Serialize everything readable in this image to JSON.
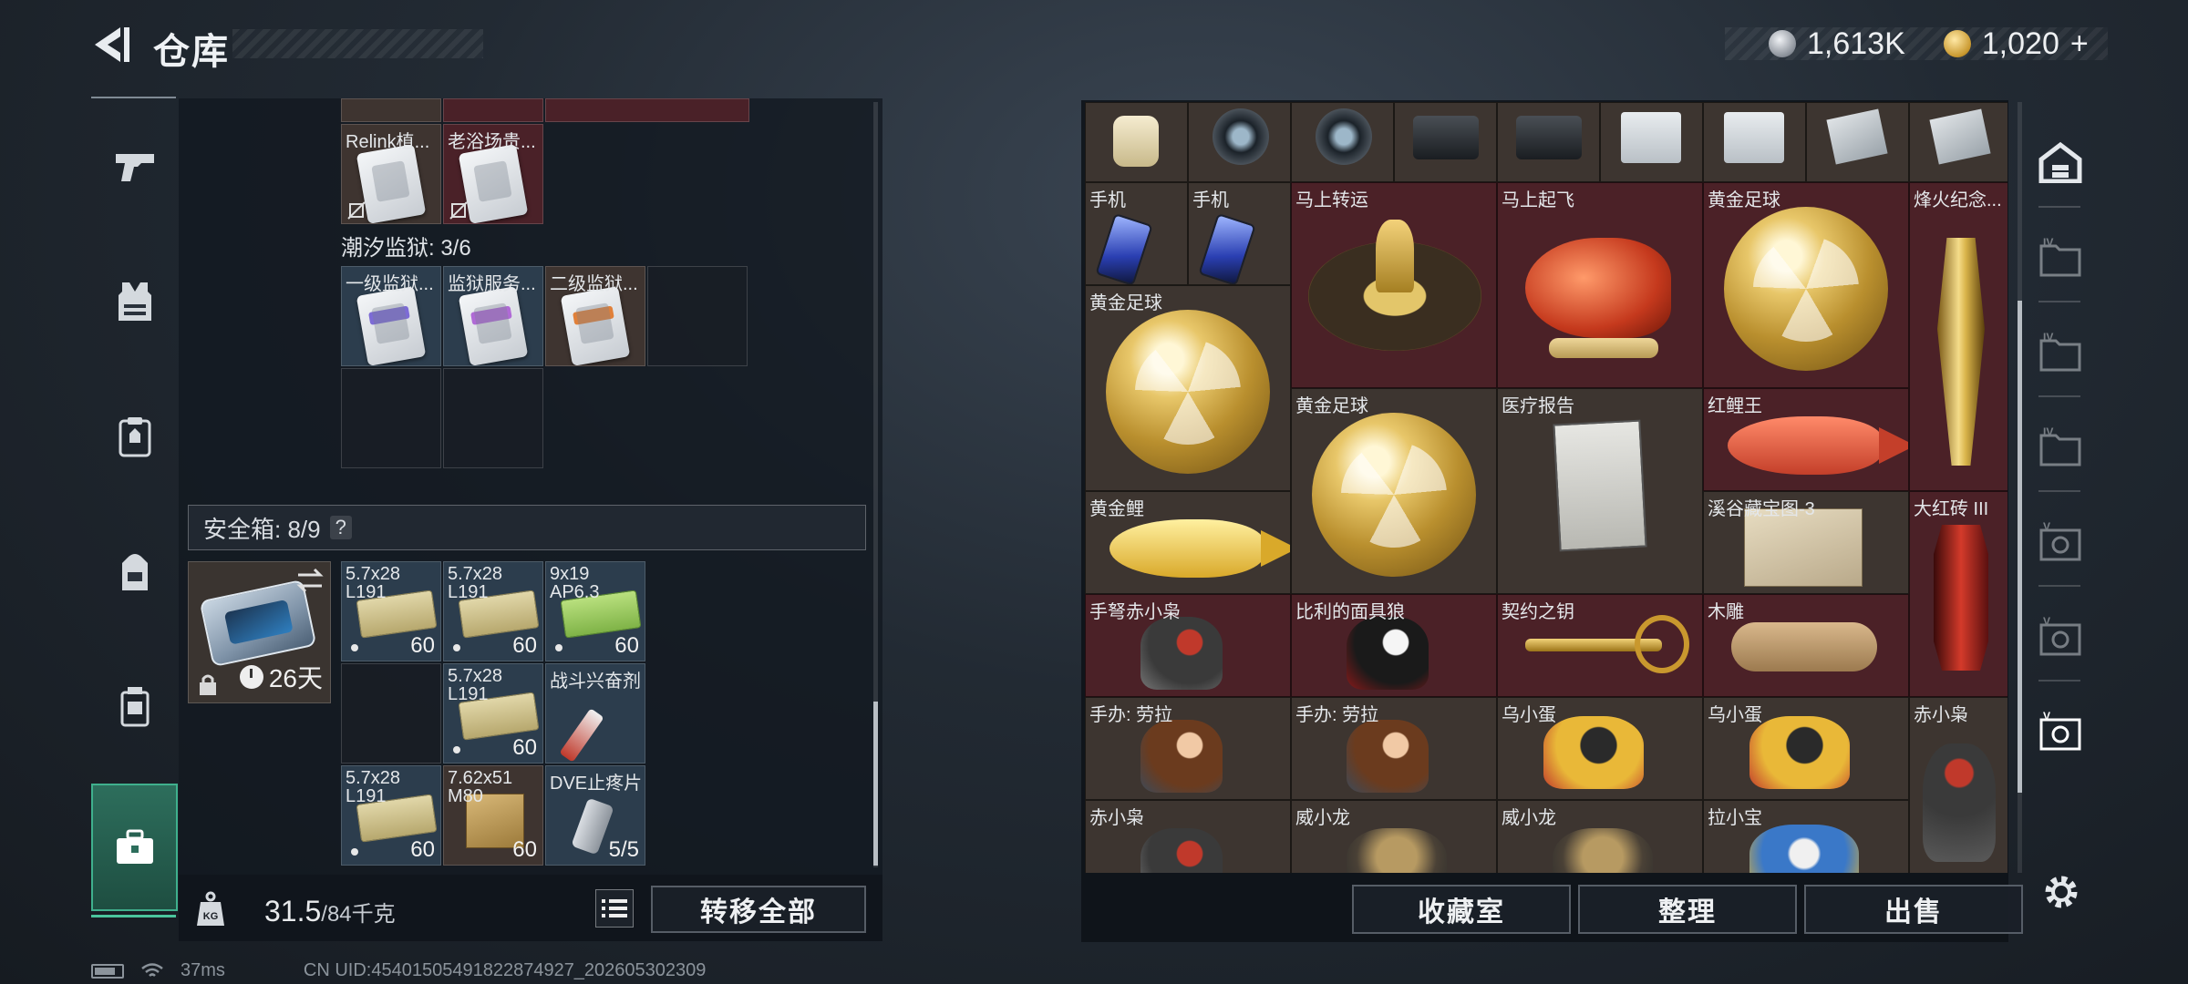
{
  "header": {
    "title": "仓库",
    "silver_amount": "1,613K",
    "gold_amount": "1,020",
    "gold_plus": "+"
  },
  "left_nav": {
    "items": [
      {
        "icon": "pistol-icon"
      },
      {
        "icon": "armor-vest-icon"
      },
      {
        "icon": "chest-rig-icon"
      },
      {
        "icon": "backpack-icon"
      },
      {
        "icon": "pouch-icon"
      },
      {
        "icon": "briefcase-icon"
      }
    ],
    "active_index": 5
  },
  "storage": {
    "top_cells": [
      {
        "label": "Relink植...",
        "bg": "brown"
      },
      {
        "label": "老浴场贵...",
        "bg": "red"
      }
    ],
    "prison_label": "潮汐监狱: 3/6",
    "prison_cells": [
      {
        "label": "一级监狱...",
        "bg": "blue"
      },
      {
        "label": "监狱服务...",
        "bg": "blue"
      },
      {
        "label": "二级监狱...",
        "bg": "brown"
      }
    ]
  },
  "safebox": {
    "label": "安全箱: 8/9",
    "help": "?",
    "days": "26天",
    "items": [
      {
        "line1": "5.7x28",
        "line2": "L191",
        "count": "60"
      },
      {
        "line1": "5.7x28",
        "line2": "L191",
        "count": "60"
      },
      {
        "line1": "9x19",
        "line2": "AP6.3",
        "count": "60"
      },
      {
        "line1": "5.7x28",
        "line2": "L191",
        "count": "60"
      },
      {
        "line1": "战斗兴奋剂",
        "line2": "",
        "count": ""
      },
      {
        "line1": "5.7x28",
        "line2": "L191",
        "count": "60"
      },
      {
        "line1": "7.62x51",
        "line2": "M80",
        "count": "60"
      },
      {
        "line1": "DVE止疼片",
        "line2": "",
        "count": "5/5"
      }
    ]
  },
  "weight": {
    "current": "31.5",
    "max": "/84千克"
  },
  "buttons": {
    "transfer_all": "转移全部",
    "collection_room": "收藏室",
    "sort": "整理",
    "sell": "出售"
  },
  "status": {
    "ping": "37ms",
    "uid": "CN UID:45401505491822874927_202605302309"
  },
  "inventory_items": [
    {
      "label": "手机"
    },
    {
      "label": "手机"
    },
    {
      "label": "马上转运"
    },
    {
      "label": "马上起飞"
    },
    {
      "label": "黄金足球"
    },
    {
      "label": "烽火纪念..."
    },
    {
      "label": "黄金足球"
    },
    {
      "label": "黄金足球"
    },
    {
      "label": "医疗报告"
    },
    {
      "label": "红鲤王"
    },
    {
      "label": "黄金鲤"
    },
    {
      "label": "溪谷藏宝图-3"
    },
    {
      "label": "大红砖 III"
    },
    {
      "label": "手弩赤小枭"
    },
    {
      "label": "比利的面具狼"
    },
    {
      "label": "契约之钥"
    },
    {
      "label": "木雕"
    },
    {
      "label": "手办: 劳拉"
    },
    {
      "label": "手办: 劳拉"
    },
    {
      "label": "乌小蛋"
    },
    {
      "label": "乌小蛋"
    },
    {
      "label": "赤小枭"
    },
    {
      "label": "赤小枭"
    },
    {
      "label": "威小龙"
    },
    {
      "label": "威小龙"
    },
    {
      "label": "拉小宝"
    }
  ],
  "right_nav": {
    "items": [
      {
        "icon": "storage-home-icon"
      },
      {
        "icon": "storage-tab-iv-1-icon"
      },
      {
        "icon": "storage-tab-iv-2-icon"
      },
      {
        "icon": "storage-tab-iv-3-icon"
      },
      {
        "icon": "storage-tab-v-1-icon"
      },
      {
        "icon": "storage-tab-v-2-icon"
      },
      {
        "icon": "storage-tab-v-3-icon"
      }
    ]
  },
  "colors": {
    "accent_green": "#3fb08d",
    "item_red_bg": "#4b2127",
    "item_brown_bg": "#3d3530"
  }
}
